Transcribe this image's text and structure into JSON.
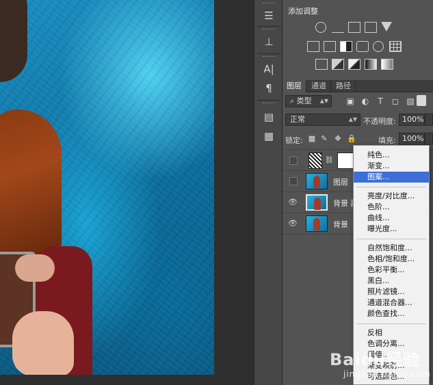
{
  "adjustments": {
    "title": "添加调整"
  },
  "layers_panel": {
    "tabs": [
      "图层",
      "通道",
      "路径"
    ],
    "filter": {
      "label": "类型"
    },
    "blend_mode": {
      "value": "正常"
    },
    "opacity": {
      "label": "不透明度:",
      "value": "100%"
    },
    "lock": {
      "label": "锁定:"
    },
    "fill": {
      "label": "填充:",
      "value": "100%"
    },
    "layers": [
      {
        "name": ""
      },
      {
        "name": "图层"
      },
      {
        "name": "背景 副"
      },
      {
        "name": "背景"
      }
    ]
  },
  "context_menu": {
    "groups": [
      [
        "纯色...",
        "渐变...",
        "图案..."
      ],
      [
        "亮度/对比度...",
        "色阶...",
        "曲线...",
        "曝光度..."
      ],
      [
        "自然饱和度...",
        "色相/饱和度...",
        "色彩平衡...",
        "黑白...",
        "照片滤镜...",
        "通道混合器...",
        "颜色查找..."
      ],
      [
        "反相",
        "色调分离...",
        "阈值...",
        "渐变映射...",
        "可选颜色..."
      ]
    ],
    "highlighted": "图案..."
  },
  "watermark": {
    "logo": "Baidu经验",
    "url": "jingyan.baidu.com"
  },
  "colors": {
    "menu_highlight": "#3d6fd6",
    "panel_bg": "#535353"
  }
}
